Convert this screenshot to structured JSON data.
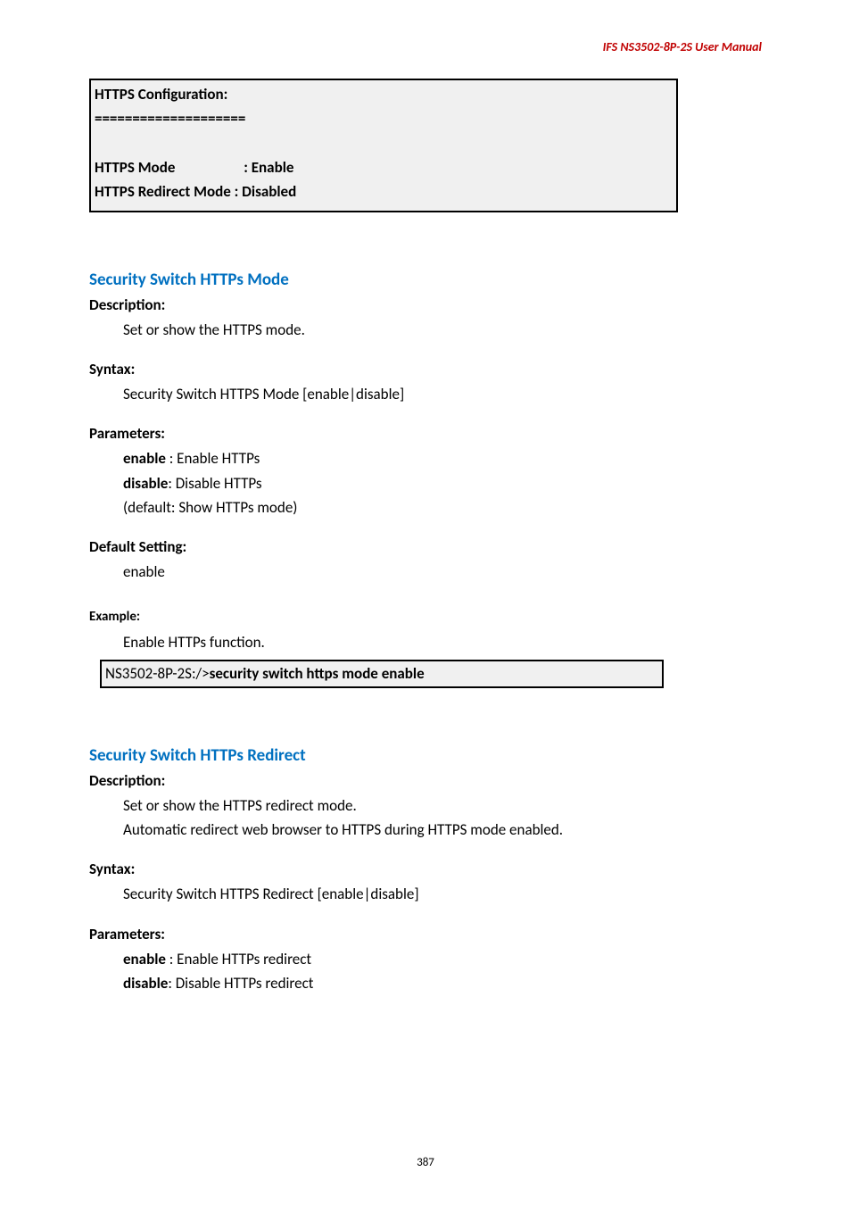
{
  "header": "IFS  NS3502-8P-2S  User  Manual",
  "box1_l1": "HTTPS Configuration:",
  "box1_l2": "====================",
  "box1_l3": "",
  "box1_l4": "HTTPS Mode                    : Enable",
  "box1_l5": "HTTPS Redirect Mode : Disabled",
  "s1": {
    "title": "Security Switch HTTPs Mode",
    "desc_h": "Description:",
    "desc_t": "Set or show the HTTPS mode.",
    "syn_h": "Syntax:",
    "syn_t": "Security Switch HTTPS Mode [enable|disable]",
    "par_h": "Parameters:",
    "par1b": "enable",
    "par1t": " : Enable HTTPs",
    "par2b": "disable",
    "par2t": ": Disable HTTPs",
    "par3": "(default: Show HTTPs mode)",
    "def_h": "Default Setting:",
    "def_t": "enable",
    "ex_h": "Example:",
    "ex_t": "Enable HTTPs function.",
    "box_pre": "NS3502-8P-2S:/>",
    "box_cmd": "security switch https mode enable"
  },
  "s2": {
    "title": "Security Switch HTTPs Redirect",
    "desc_h": "Description:",
    "desc_t1": "Set or show the HTTPS redirect mode.",
    "desc_t2": "Automatic redirect web browser to HTTPS during HTTPS mode enabled.",
    "syn_h": "Syntax:",
    "syn_t": "Security Switch HTTPS Redirect [enable|disable]",
    "par_h": "Parameters:",
    "par1b": "enable",
    "par1t": " : Enable HTTPs redirect",
    "par2b": "disable",
    "par2t": ": Disable HTTPs redirect"
  },
  "page_num": "387"
}
